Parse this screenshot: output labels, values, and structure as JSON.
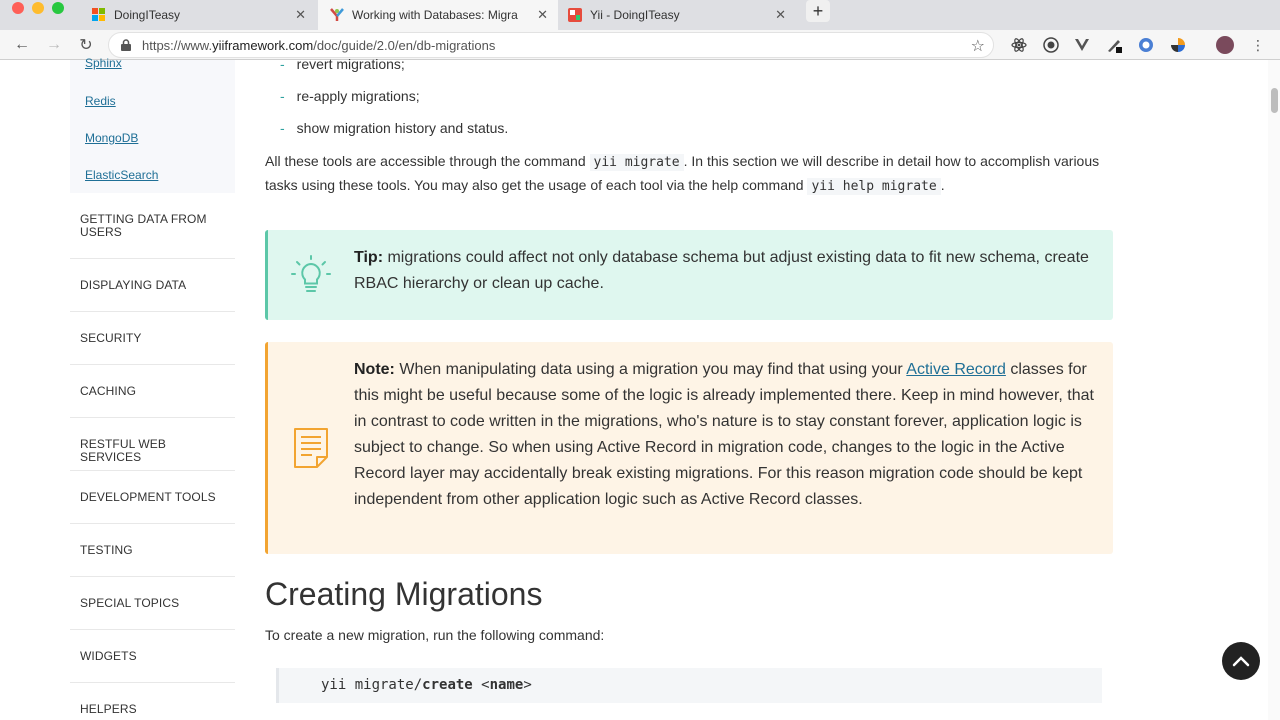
{
  "tabs": [
    {
      "title": "DoingITeasy",
      "active": false
    },
    {
      "title": "Working with Databases: Migra",
      "active": true
    },
    {
      "title": "Yii - DoingITeasy",
      "active": false
    }
  ],
  "address": {
    "prefix": "https://www.",
    "host": "yiiframework.com",
    "path": "/doc/guide/2.0/en/db-migrations"
  },
  "sidebar": {
    "links": [
      "Sphinx",
      "Redis",
      "MongoDB",
      "ElasticSearch"
    ],
    "sections": [
      "GETTING DATA FROM USERS",
      "DISPLAYING DATA",
      "SECURITY",
      "CACHING",
      "RESTFUL WEB SERVICES",
      "DEVELOPMENT TOOLS",
      "TESTING",
      "SPECIAL TOPICS",
      "WIDGETS",
      "HELPERS"
    ]
  },
  "content": {
    "list_items": [
      "revert migrations;",
      "re-apply migrations;",
      "show migration history and status."
    ],
    "para": {
      "t1": "All these tools are accessible through the command ",
      "c1": "yii migrate",
      "t2": ". In this section we will describe in detail how to accomplish various tasks using these tools. You may also get the usage of each tool via the help command ",
      "c2": "yii help migrate",
      "t3": "."
    },
    "tip": {
      "label": "Tip:",
      "text": " migrations could affect not only database schema but adjust existing data to fit new schema, create RBAC hierarchy or clean up cache."
    },
    "note": {
      "label": "Note:",
      "t1": " When manipulating data using a migration you may find that using your ",
      "link": "Active Record",
      "t2": " classes for this might be useful because some of the logic is already implemented there. Keep in mind however, that in contrast to code written in the migrations, who's nature is to stay constant forever, application logic is subject to change. So when using Active Record in migration code, changes to the logic in the Active Record layer may accidentally break existing migrations. For this reason migration code should be kept independent from other application logic such as Active Record classes."
    },
    "heading": "Creating Migrations",
    "cmd_intro": "To create a new migration, run the following command:",
    "code": {
      "a": "yii migrate/",
      "b": "create",
      "c": " <",
      "d": "name",
      "e": ">"
    }
  },
  "colors": {
    "tip_accent": "#5cc7a8",
    "note_accent": "#f2a431",
    "link": "#1f6f96"
  }
}
